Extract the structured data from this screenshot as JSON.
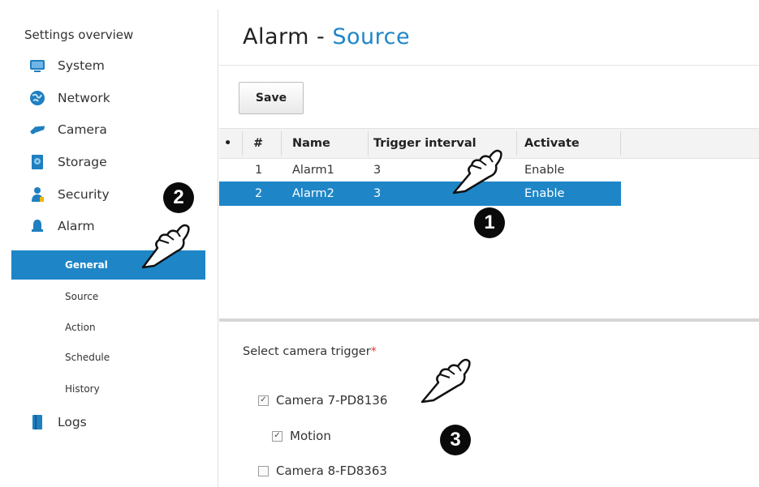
{
  "sidebar": {
    "title": "Settings overview",
    "items": [
      {
        "label": "System",
        "icon": "system-icon"
      },
      {
        "label": "Network",
        "icon": "network-icon"
      },
      {
        "label": "Camera",
        "icon": "camera-icon"
      },
      {
        "label": "Storage",
        "icon": "storage-icon"
      },
      {
        "label": "Security",
        "icon": "security-icon"
      },
      {
        "label": "Alarm",
        "icon": "alarm-icon"
      },
      {
        "label": "Logs",
        "icon": "logs-icon"
      }
    ],
    "alarm_subitems": [
      {
        "label": "General",
        "active": true
      },
      {
        "label": "Source",
        "active": false
      },
      {
        "label": "Action",
        "active": false
      },
      {
        "label": "Schedule",
        "active": false
      },
      {
        "label": "History",
        "active": false
      }
    ]
  },
  "page": {
    "title_prefix": "Alarm - ",
    "title_accent": "Source"
  },
  "toolbar": {
    "save_label": "Save"
  },
  "table": {
    "columns": [
      "•",
      "#",
      "Name",
      "Trigger interval",
      "Activate"
    ],
    "rows": [
      {
        "num": "1",
        "name": "Alarm1",
        "interval": "3",
        "activate": "Enable",
        "selected": false
      },
      {
        "num": "2",
        "name": "Alarm2",
        "interval": "3",
        "activate": "Enable",
        "selected": true
      }
    ]
  },
  "trigger": {
    "label": "Select camera trigger",
    "required_mark": "*",
    "options": [
      {
        "label": "Camera 7-PD8136",
        "checked": true
      },
      {
        "label": "Motion",
        "checked": true
      },
      {
        "label": "Camera 8-FD8363",
        "checked": false
      }
    ]
  },
  "callouts": [
    "1",
    "2",
    "3"
  ],
  "colors": {
    "accent": "#1e86c7",
    "required": "#e53935",
    "callout": "#0a0a0a"
  }
}
